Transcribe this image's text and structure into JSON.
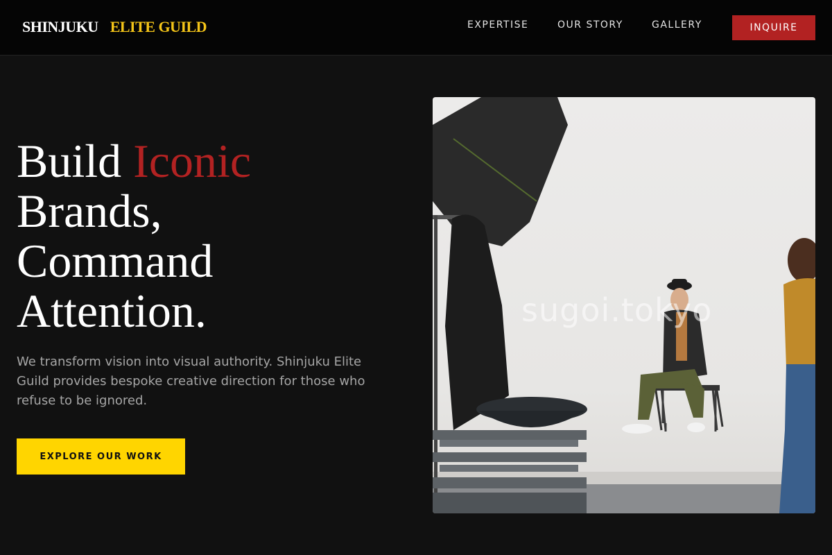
{
  "header": {
    "brand_part1": "SHINJUKU",
    "brand_part2": "ELITE GUILD",
    "nav": [
      {
        "label": "EXPERTISE"
      },
      {
        "label": "OUR STORY"
      },
      {
        "label": "GALLERY"
      }
    ],
    "cta_label": "INQUIRE"
  },
  "hero": {
    "title_word1": "Build",
    "title_accent": "Iconic",
    "title_line2": "Brands,",
    "title_line3": "Command",
    "title_line4": "Attention.",
    "subtitle": "We transform vision into visual authority. Shinjuku Elite Guild provides bespoke creative direction for those who refuse to be ignored.",
    "cta_label": "EXPLORE OUR WORK"
  },
  "photo": {
    "watermark": "sugoi.tokyo"
  },
  "colors": {
    "background": "#111111",
    "header_bg": "#050505",
    "accent_red": "#b22222",
    "accent_yellow": "#ffd500",
    "brand_gold": "#f5c518"
  }
}
